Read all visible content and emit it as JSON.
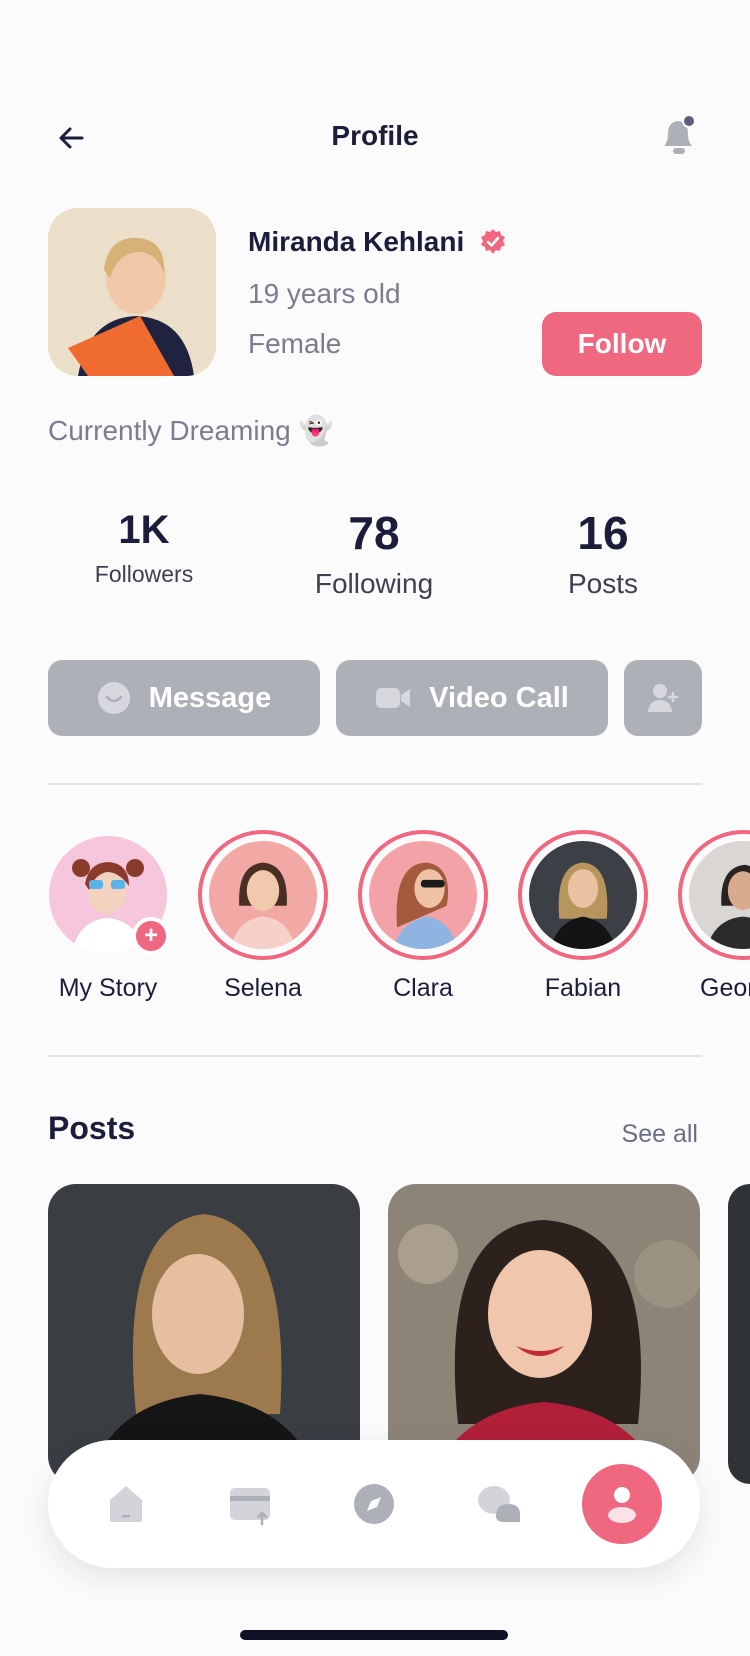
{
  "header": {
    "title": "Profile",
    "icons": [
      "back-arrow-icon",
      "bell-icon"
    ]
  },
  "profile": {
    "name": "Miranda Kehlani",
    "age": "19 years old",
    "gender": "Female",
    "follow_label": "Follow",
    "status": "Currently Dreaming 👻"
  },
  "stats": [
    {
      "value": "1K",
      "label": "Followers"
    },
    {
      "value": "78",
      "label": "Following"
    },
    {
      "value": "16",
      "label": "Posts"
    }
  ],
  "actions": {
    "message": "Message",
    "video_call": "Video Call"
  },
  "stories": [
    {
      "label": "My Story"
    },
    {
      "label": "Selena"
    },
    {
      "label": "Clara"
    },
    {
      "label": "Fabian"
    },
    {
      "label": "Geor"
    }
  ],
  "posts_section": {
    "title": "Posts",
    "see_all": "See all"
  },
  "colors": {
    "accent": "#ef6880",
    "muted_button": "#aeb0b8",
    "text": "#1c1d3a",
    "secondary_text": "#7b7d8f"
  }
}
